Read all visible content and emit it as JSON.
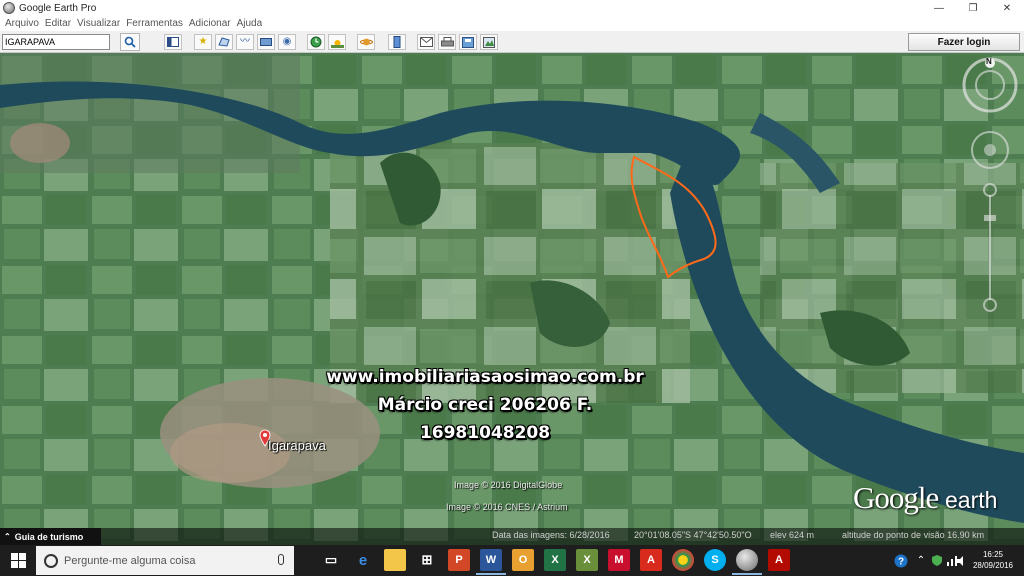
{
  "window": {
    "title": "Google Earth Pro",
    "minimize": "—",
    "maximize": "❐",
    "close": "✕"
  },
  "menu": [
    "Arquivo",
    "Editar",
    "Visualizar",
    "Ferramentas",
    "Adicionar",
    "Ajuda"
  ],
  "toolbar": {
    "search_value": "IGARAPAVA",
    "login_label": "Fazer login"
  },
  "map": {
    "overlay_lines": [
      "www.imobiliariasaosimao.com.br",
      "Márcio creci 206206 F.",
      "16981048208"
    ],
    "place_label": "Igarapava",
    "credit_1": "Image © 2016 DigitalGlobe",
    "credit_2": "Image © 2016 CNES / Astrium",
    "logo_google": "Google",
    "logo_earth": "earth",
    "compass_north": "N",
    "water_color": "#1f4a5c",
    "boundary_color": "#ff6a1a"
  },
  "status": {
    "tour_label": "Guia de turismo",
    "imagery_date": "Data das imagens: 6/28/2016",
    "coordinates": "20°01'08.05\"S   47°42'50.50\"O",
    "elevation": "elev   624 m",
    "eye_altitude": "altitude do ponto de visão  16.90 km"
  },
  "taskbar": {
    "search_placeholder": "Pergunte-me alguma coisa",
    "time": "16:25",
    "date": "28/09/2016"
  }
}
